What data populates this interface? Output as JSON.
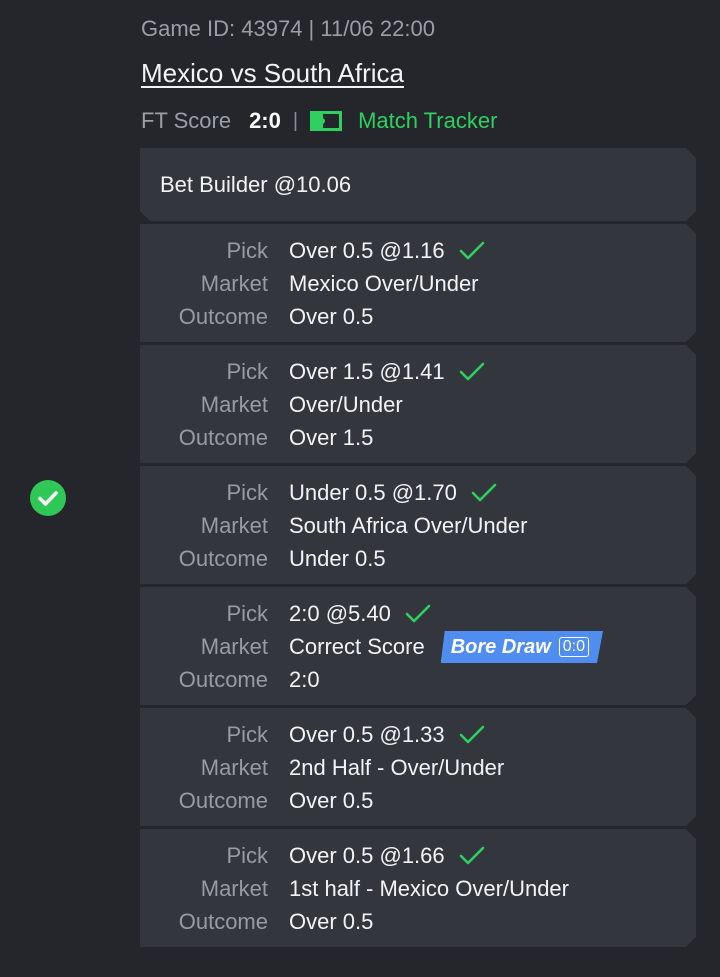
{
  "header": {
    "game_id": "Game ID: 43974 | 11/06 22:00",
    "match_title": "Mexico vs South Africa",
    "ft_label": "FT Score",
    "ft_value": "2:0",
    "separator": "|",
    "tracker_label": "Match Tracker"
  },
  "builder": {
    "label": "Bet Builder @10.06"
  },
  "labels": {
    "pick": "Pick",
    "market": "Market",
    "outcome": "Outcome"
  },
  "legs": [
    {
      "pick": "Over 0.5 @1.16",
      "market": "Mexico Over/Under",
      "outcome": "Over 0.5"
    },
    {
      "pick": "Over 1.5 @1.41",
      "market": "Over/Under",
      "outcome": "Over 1.5"
    },
    {
      "pick": "Under 0.5 @1.70",
      "market": "South Africa Over/Under",
      "outcome": "Under 0.5"
    },
    {
      "pick": "2:0 @5.40",
      "market": "Correct Score",
      "outcome": "2:0",
      "badge": {
        "label": "Bore Draw",
        "score": "0:0"
      }
    },
    {
      "pick": "Over 0.5 @1.33",
      "market": "2nd Half - Over/Under",
      "outcome": "Over 0.5"
    },
    {
      "pick": "Over 0.5 @1.66",
      "market": "1st half - Mexico Over/Under",
      "outcome": "Over 0.5"
    }
  ],
  "colors": {
    "background": "#24262b",
    "card": "#33363d",
    "win_green": "#2ed15f",
    "badge_blue": "#4f8df0"
  },
  "icons": {
    "status": "check-circle-icon",
    "tracker": "field-icon",
    "leg_result": "check-icon"
  }
}
